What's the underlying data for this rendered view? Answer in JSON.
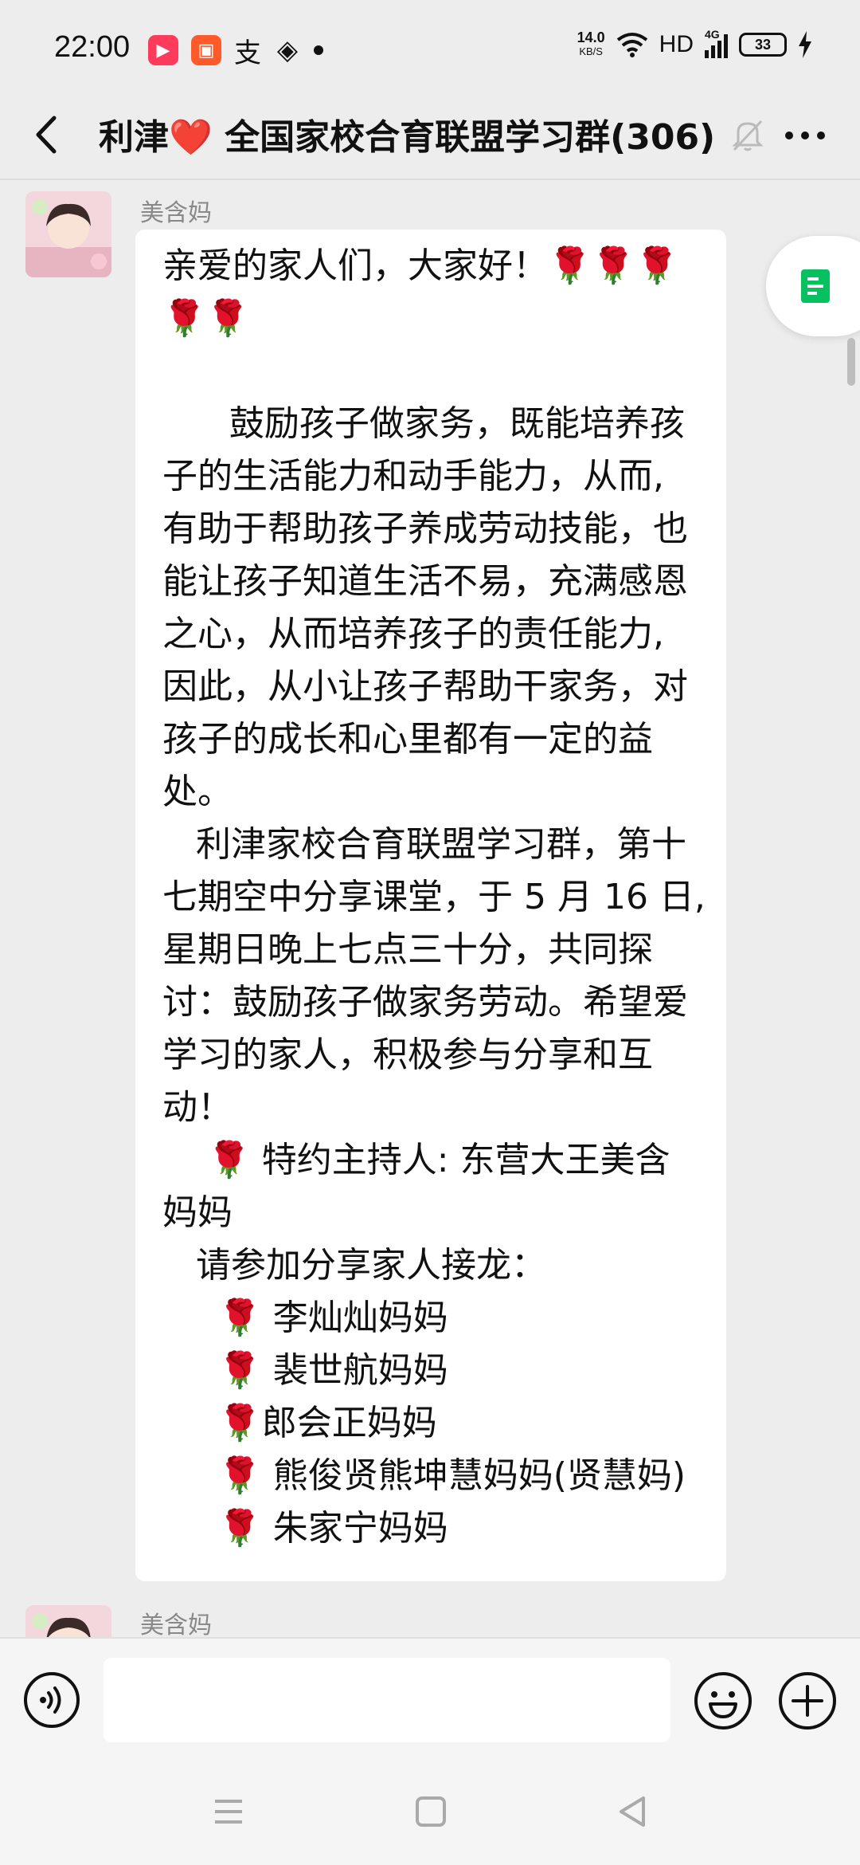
{
  "status_bar": {
    "time": "22:00",
    "app_icons": [
      "douyin-icon",
      "kuaishou-icon",
      "alipay-icon",
      "layers-icon"
    ],
    "network_speed": "14.0",
    "network_speed_unit": "KB/S",
    "hd_label": "HD",
    "signal_label": "4G",
    "battery_level": "33"
  },
  "header": {
    "title": "利津❤️ 全国家校合育联盟学习群(306)"
  },
  "messages": [
    {
      "sender": "美含妈",
      "lines": [
        "亲爱的家人们，大家好！🌹🌹🌹",
        "🌹🌹",
        "",
        "      鼓励孩子做家务，既能培养孩",
        "子的生活能力和动手能力，从而,",
        "有助于帮助孩子养成劳动技能，也",
        "能让孩子知道生活不易，充满感恩",
        "之心，从而培养孩子的责任能力,",
        "因此，从小让孩子帮助干家务，对",
        "孩子的成长和心里都有一定的益",
        "处。",
        "   利津家校合育联盟学习群，第十",
        "七期空中分享课堂，于 5 月 16 日,",
        "星期日晚上七点三十分，共同探",
        "讨：鼓励孩子做家务劳动。希望爱",
        "学习的家人，积极参与分享和互",
        "动！",
        "    🌹 特约主持人: 东营大王美含",
        "妈妈",
        "   请参加分享家人接龙：",
        "     🌹 李灿灿妈妈",
        "     🌹 裴世航妈妈",
        "     🌹郎会正妈妈",
        "     🌹 熊俊贤熊坤慧妈妈(贤慧妈)",
        "     🌹 朱家宁妈妈"
      ]
    },
    {
      "sender": "美含妈"
    }
  ],
  "input_bar": {
    "placeholder": ""
  },
  "colors": {
    "background": "#ededed",
    "bubble": "#ffffff",
    "accent_green": "#07c160",
    "name_gray": "#888888"
  }
}
